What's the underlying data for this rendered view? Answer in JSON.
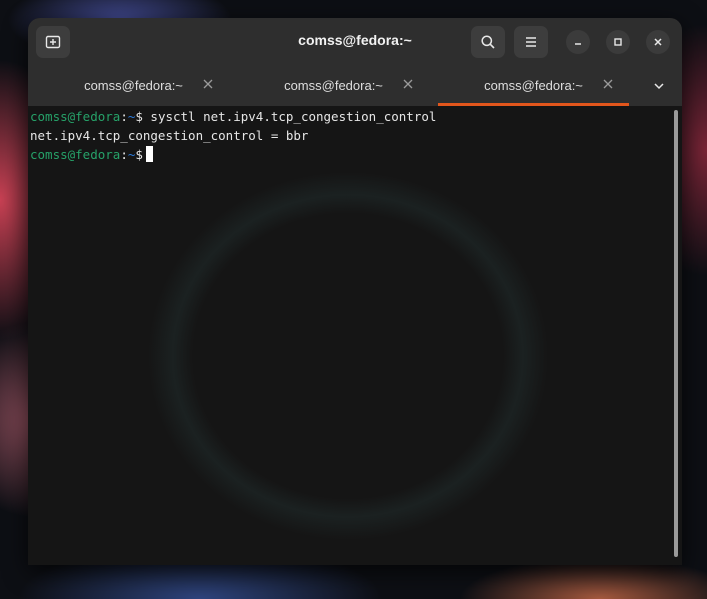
{
  "window": {
    "title": "comss@fedora:~"
  },
  "headerbar": {
    "new_tab_icon": "new-tab-icon",
    "search_icon": "search-icon",
    "menu_icon": "hamburger-menu-icon",
    "minimize_icon": "minimize-icon",
    "maximize_icon": "maximize-icon",
    "close_icon": "close-icon"
  },
  "tabs": [
    {
      "label": "comss@fedora:~",
      "active": false
    },
    {
      "label": "comss@fedora:~",
      "active": false
    },
    {
      "label": "comss@fedora:~",
      "active": true
    }
  ],
  "tabs_menu_icon": "chevron-down-icon",
  "terminal": {
    "lines": [
      {
        "user": "comss@fedora",
        "colon": ":",
        "path": "~",
        "symbol": "$",
        "command": " sysctl net.ipv4.tcp_congestion_control"
      },
      {
        "output": "net.ipv4.tcp_congestion_control = bbr"
      },
      {
        "user": "comss@fedora",
        "colon": ":",
        "path": "~",
        "symbol": "$",
        "command": " "
      }
    ]
  },
  "colors": {
    "accent": "#e2561c",
    "prompt_user": "#26a269",
    "prompt_path": "#2a7bde",
    "headerbar": "#2e2e2e"
  }
}
